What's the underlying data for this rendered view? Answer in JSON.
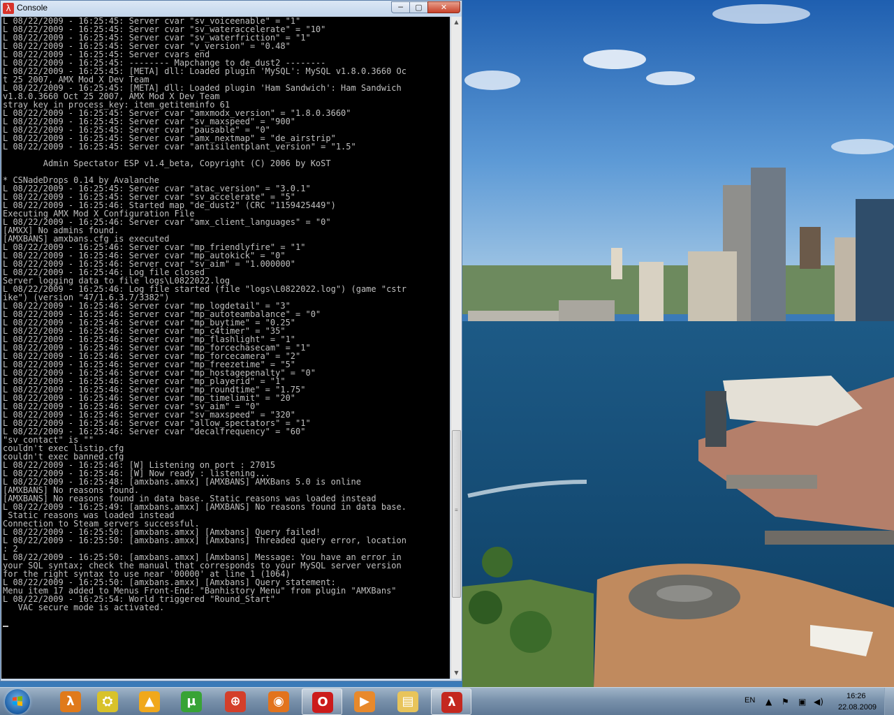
{
  "window": {
    "title": "Console",
    "icon": "half-life-lambda-icon",
    "minimize_label": "─",
    "maximize_label": "▢",
    "close_label": "✕"
  },
  "console": {
    "lines": [
      "L 08/22/2009 - 16:25:45: Server cvar \"sv_voiceenable\" = \"1\"",
      "L 08/22/2009 - 16:25:45: Server cvar \"sv_wateraccelerate\" = \"10\"",
      "L 08/22/2009 - 16:25:45: Server cvar \"sv_waterfriction\" = \"1\"",
      "L 08/22/2009 - 16:25:45: Server cvar \"v_version\" = \"0.48\"",
      "L 08/22/2009 - 16:25:45: Server cvars end",
      "L 08/22/2009 - 16:25:45: -------- Mapchange to de_dust2 --------",
      "L 08/22/2009 - 16:25:45: [META] dll: Loaded plugin 'MySQL': MySQL v1.8.0.3660 Oc",
      "t 25 2007, AMX Mod X Dev Team",
      "L 08/22/2009 - 16:25:45: [META] dll: Loaded plugin 'Ham Sandwich': Ham Sandwich",
      "v1.8.0.3660 Oct 25 2007, AMX Mod X Dev Team",
      "stray key in process_key: item_getiteminfo 61",
      "L 08/22/2009 - 16:25:45: Server cvar \"amxmodx_version\" = \"1.8.0.3660\"",
      "L 08/22/2009 - 16:25:45: Server cvar \"sv_maxspeed\" = \"900\"",
      "L 08/22/2009 - 16:25:45: Server cvar \"pausable\" = \"0\"",
      "L 08/22/2009 - 16:25:45: Server cvar \"amx_nextmap\" = \"de_airstrip\"",
      "L 08/22/2009 - 16:25:45: Server cvar \"antisilentplant_version\" = \"1.5\"",
      "",
      "        Admin Spectator ESP v1.4_beta, Copyright (C) 2006 by KoST",
      "",
      "* CSNadeDrops 0.14 by Avalanche",
      "L 08/22/2009 - 16:25:45: Server cvar \"atac_version\" = \"3.0.1\"",
      "L 08/22/2009 - 16:25:45: Server cvar \"sv_accelerate\" = \"5\"",
      "L 08/22/2009 - 16:25:46: Started map \"de_dust2\" (CRC \"1159425449\")",
      "Executing AMX Mod X Configuration File",
      "L 08/22/2009 - 16:25:46: Server cvar \"amx_client_languages\" = \"0\"",
      "[AMXX] No admins found.",
      "[AMXBANS] amxbans.cfg is executed",
      "L 08/22/2009 - 16:25:46: Server cvar \"mp_friendlyfire\" = \"1\"",
      "L 08/22/2009 - 16:25:46: Server cvar \"mp_autokick\" = \"0\"",
      "L 08/22/2009 - 16:25:46: Server cvar \"sv_aim\" = \"1.000000\"",
      "L 08/22/2009 - 16:25:46: Log file closed",
      "Server logging data to file logs\\L0822022.log",
      "L 08/22/2009 - 16:25:46: Log file started (file \"logs\\L0822022.log\") (game \"cstr",
      "ike\") (version \"47/1.6.3.7/3382\")",
      "L 08/22/2009 - 16:25:46: Server cvar \"mp_logdetail\" = \"3\"",
      "L 08/22/2009 - 16:25:46: Server cvar \"mp_autoteambalance\" = \"0\"",
      "L 08/22/2009 - 16:25:46: Server cvar \"mp_buytime\" = \"0.25\"",
      "L 08/22/2009 - 16:25:46: Server cvar \"mp_c4timer\" = \"35\"",
      "L 08/22/2009 - 16:25:46: Server cvar \"mp_flashlight\" = \"1\"",
      "L 08/22/2009 - 16:25:46: Server cvar \"mp_forcechasecam\" = \"1\"",
      "L 08/22/2009 - 16:25:46: Server cvar \"mp_forcecamera\" = \"2\"",
      "L 08/22/2009 - 16:25:46: Server cvar \"mp_freezetime\" = \"5\"",
      "L 08/22/2009 - 16:25:46: Server cvar \"mp_hostagepenalty\" = \"0\"",
      "L 08/22/2009 - 16:25:46: Server cvar \"mp_playerid\" = \"1\"",
      "L 08/22/2009 - 16:25:46: Server cvar \"mp_roundtime\" = \"1.75\"",
      "L 08/22/2009 - 16:25:46: Server cvar \"mp_timelimit\" = \"20\"",
      "L 08/22/2009 - 16:25:46: Server cvar \"sv_aim\" = \"0\"",
      "L 08/22/2009 - 16:25:46: Server cvar \"sv_maxspeed\" = \"320\"",
      "L 08/22/2009 - 16:25:46: Server cvar \"allow_spectators\" = \"1\"",
      "L 08/22/2009 - 16:25:46: Server cvar \"decalfrequency\" = \"60\"",
      "\"sv_contact\" is \"\"",
      "couldn't exec listip.cfg",
      "couldn't exec banned.cfg",
      "L 08/22/2009 - 16:25:46: [W] Listening on port : 27015",
      "L 08/22/2009 - 16:25:46: [W] Now ready : listening...",
      "L 08/22/2009 - 16:25:48: [amxbans.amxx] [AMXBANS] AMXBans 5.0 is online",
      "[AMXBANS] No reasons found.",
      "[AMXBANS] No reasons found in data base. Static reasons was loaded instead",
      "L 08/22/2009 - 16:25:49: [amxbans.amxx] [AMXBANS] No reasons found in data base.",
      " Static reasons was loaded instead",
      "Connection to Steam servers successful.",
      "L 08/22/2009 - 16:25:50: [amxbans.amxx] [Amxbans] Query failed!",
      "L 08/22/2009 - 16:25:50: [amxbans.amxx] [Amxbans] Threaded query error, location",
      ": 2",
      "L 08/22/2009 - 16:25:50: [amxbans.amxx] [Amxbans] Message: You have an error in",
      "your SQL syntax; check the manual that corresponds to your MySQL server version",
      "for the right syntax to use near '00000' at line 1 (1064)",
      "L 08/22/2009 - 16:25:50: [amxbans.amxx] [Amxbans] Query statement:",
      "Menu item 17 added to Menus Front-End: \"Banhistory Menu\" from plugin \"AMXBans\"",
      "L 08/22/2009 - 16:25:54: World triggered \"Round_Start\"",
      "   VAC secure mode is activated.",
      ""
    ]
  },
  "taskbar": {
    "start_icon": "windows-start-orb-icon",
    "buttons": [
      {
        "icon": "half-life-icon",
        "glyph": "λ",
        "color": "#e07a1a",
        "active": false
      },
      {
        "icon": "game-server-icon",
        "glyph": "⛭",
        "color": "#d8c22a",
        "active": false
      },
      {
        "icon": "aimp-player-icon",
        "glyph": "▲",
        "color": "#f0a81c",
        "active": false
      },
      {
        "icon": "utorrent-icon",
        "glyph": "µ",
        "color": "#38a335",
        "active": false
      },
      {
        "icon": "cs-icon",
        "glyph": "⊕",
        "color": "#d43f2a",
        "active": false
      },
      {
        "icon": "firefox-icon",
        "glyph": "◉",
        "color": "#e2731c",
        "active": false
      },
      {
        "icon": "opera-icon",
        "glyph": "O",
        "color": "#cc1b1b",
        "active": true
      },
      {
        "icon": "media-player-icon",
        "glyph": "▶",
        "color": "#e8892b",
        "active": false
      },
      {
        "icon": "explorer-folder-icon",
        "glyph": "▤",
        "color": "#e8c45a",
        "active": false
      },
      {
        "icon": "half-life-console-icon",
        "glyph": "λ",
        "color": "#c4281f",
        "active": true
      }
    ],
    "language": "EN",
    "tray_icons": [
      "show-hidden-icon",
      "action-center-flag-icon",
      "network-icon",
      "volume-icon"
    ],
    "tray_glyphs": [
      "▲",
      "⚑",
      "▣",
      "◀)"
    ],
    "time": "16:26",
    "date": "22.08.2009"
  }
}
